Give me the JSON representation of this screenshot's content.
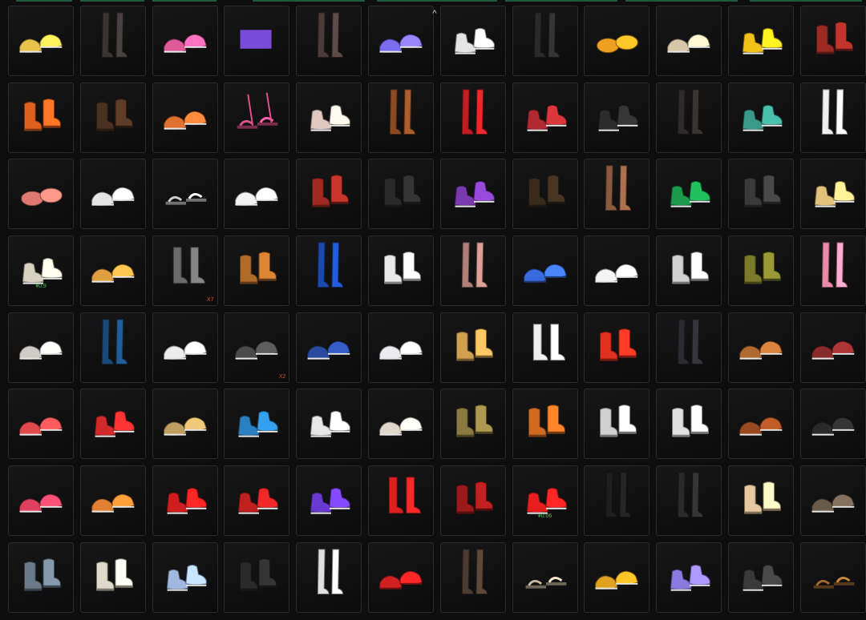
{
  "scroll_up": "^",
  "items": [
    {
      "icon": "sneakers-icon",
      "c": "#e8c24a"
    },
    {
      "icon": "legs-boots-icon",
      "c": "#3a3434"
    },
    {
      "icon": "sneakers-icon",
      "c": "#e05a9a"
    },
    {
      "icon": "strap-sneakers-icon",
      "c": "#7a4ad8"
    },
    {
      "icon": "fishnet-legs-icon",
      "c": "#4a3c38"
    },
    {
      "icon": "flats-icon",
      "c": "#7b6cf0"
    },
    {
      "icon": "cleats-icon",
      "c": "#e4e4e4"
    },
    {
      "icon": "tall-boots-icon",
      "c": "#2a2a2a"
    },
    {
      "icon": "slippers-icon",
      "c": "#f0a020"
    },
    {
      "icon": "sneakers-icon",
      "c": "#d8c6a8"
    },
    {
      "icon": "high-tops-icon",
      "c": "#f2c21a"
    },
    {
      "icon": "boots-icon",
      "c": "#9a2a22"
    },
    {
      "icon": "boots-icon",
      "c": "#e0601e"
    },
    {
      "icon": "boots-icon",
      "c": "#4a3020"
    },
    {
      "icon": "sneakers-icon",
      "c": "#e07030"
    },
    {
      "icon": "lace-sandals-icon",
      "c": "#e0508a"
    },
    {
      "icon": "high-tops-icon",
      "c": "#e0c8c0"
    },
    {
      "icon": "tall-boots-icon",
      "c": "#8a4a22"
    },
    {
      "icon": "tall-boots-icon",
      "c": "#c01e22"
    },
    {
      "icon": "high-tops-icon",
      "c": "#b02a30"
    },
    {
      "icon": "high-tops-icon",
      "c": "#2c2c2c"
    },
    {
      "icon": "legs-boots-icon",
      "c": "#2e2a2a"
    },
    {
      "icon": "high-tops-icon",
      "c": "#3a9a8a"
    },
    {
      "icon": "stockings-icon",
      "c": "#f0f0f0"
    },
    {
      "icon": "slippers-icon",
      "c": "#e07a70"
    },
    {
      "icon": "flats-icon",
      "c": "#e6e6e6"
    },
    {
      "icon": "sandals-icon",
      "c": "#cfcfcf"
    },
    {
      "icon": "sneakers-icon",
      "c": "#f2f2f2"
    },
    {
      "icon": "boots-icon",
      "c": "#a02a22"
    },
    {
      "icon": "boots-icon",
      "c": "#2a2a2a"
    },
    {
      "icon": "high-tops-icon",
      "c": "#7a3ab0"
    },
    {
      "icon": "boots-icon",
      "c": "#3a2a1a"
    },
    {
      "icon": "legs-boots-icon",
      "c": "#8a5a40"
    },
    {
      "icon": "high-tops-icon",
      "c": "#1a9a4a"
    },
    {
      "icon": "boots-icon",
      "c": "#3a3a3a"
    },
    {
      "icon": "high-tops-icon",
      "c": "#e2c27a"
    },
    {
      "icon": "high-tops-icon",
      "c": "#d8d0c0",
      "price": "¥0.9"
    },
    {
      "icon": "sneakers-icon",
      "c": "#e0a040"
    },
    {
      "icon": "socks-icon",
      "c": "#6a6a6a",
      "qty": "X7"
    },
    {
      "icon": "boots-icon",
      "c": "#b06a2a"
    },
    {
      "icon": "tall-boots-icon",
      "c": "#1a4ab0"
    },
    {
      "icon": "boots-icon",
      "c": "#e8e8e8"
    },
    {
      "icon": "legs-boots-icon",
      "c": "#b08078"
    },
    {
      "icon": "flip-flops-icon",
      "c": "#3a6ae0"
    },
    {
      "icon": "flats-icon",
      "c": "#f4f4f4"
    },
    {
      "icon": "boots-icon",
      "c": "#d0d0d0"
    },
    {
      "icon": "boots-icon",
      "c": "#7a7a2a"
    },
    {
      "icon": "stockings-icon",
      "c": "#e88aa8"
    },
    {
      "icon": "sneakers-icon",
      "c": "#d0ccc8"
    },
    {
      "icon": "tall-boots-icon",
      "c": "#1a4a7a"
    },
    {
      "icon": "sneakers-icon",
      "c": "#ececec"
    },
    {
      "icon": "loafers-icon",
      "c": "#4a4a4a",
      "qty": "X2"
    },
    {
      "icon": "loafers-icon",
      "c": "#2a4aa0"
    },
    {
      "icon": "sneakers-icon",
      "c": "#ececf0"
    },
    {
      "icon": "boots-icon",
      "c": "#d0a050"
    },
    {
      "icon": "socks-icon",
      "c": "#f0f0f0"
    },
    {
      "icon": "boots-icon",
      "c": "#e0301e"
    },
    {
      "icon": "tall-boots-icon",
      "c": "#2a2a30"
    },
    {
      "icon": "sneakers-icon",
      "c": "#b06a30"
    },
    {
      "icon": "loafers-icon",
      "c": "#8a2a2a"
    },
    {
      "icon": "sneakers-icon",
      "c": "#e04a4a"
    },
    {
      "icon": "high-tops-icon",
      "c": "#d02a2a"
    },
    {
      "icon": "sneakers-icon",
      "c": "#c0a060"
    },
    {
      "icon": "high-tops-icon",
      "c": "#2a80c0"
    },
    {
      "icon": "high-tops-icon",
      "c": "#e8e8e8"
    },
    {
      "icon": "loafers-icon",
      "c": "#e0d8c8"
    },
    {
      "icon": "boots-icon",
      "c": "#8a7a40"
    },
    {
      "icon": "boots-icon",
      "c": "#d06a20"
    },
    {
      "icon": "boots-icon",
      "c": "#d0d0d0"
    },
    {
      "icon": "boots-icon",
      "c": "#e0e0e0"
    },
    {
      "icon": "loafers-icon",
      "c": "#9a4a20"
    },
    {
      "icon": "loafers-icon",
      "c": "#2a2a2a"
    },
    {
      "icon": "sneakers-icon",
      "c": "#e04060"
    },
    {
      "icon": "sneakers-icon",
      "c": "#e08030"
    },
    {
      "icon": "high-tops-icon",
      "c": "#d01e1e"
    },
    {
      "icon": "high-tops-icon",
      "c": "#c02020"
    },
    {
      "icon": "high-tops-icon",
      "c": "#6a3ad0"
    },
    {
      "icon": "socks-icon",
      "c": "#e02020"
    },
    {
      "icon": "boots-icon",
      "c": "#9a1a1a"
    },
    {
      "icon": "high-tops-icon",
      "c": "#e81e1e",
      "price": "¥0.06"
    },
    {
      "icon": "tall-boots-icon",
      "c": "#1e1e1e"
    },
    {
      "icon": "tall-boots-icon",
      "c": "#2a2a2a"
    },
    {
      "icon": "boots-icon",
      "c": "#e8c8a0"
    },
    {
      "icon": "loafers-icon",
      "c": "#6a5a4a"
    },
    {
      "icon": "boots-icon",
      "c": "#6a7a8a"
    },
    {
      "icon": "boots-icon",
      "c": "#e0d8c8"
    },
    {
      "icon": "high-tops-icon",
      "c": "#a0b8e0"
    },
    {
      "icon": "boots-icon",
      "c": "#2a2a2a"
    },
    {
      "icon": "stockings-icon",
      "c": "#e0e0e0"
    },
    {
      "icon": "flip-flops-icon",
      "c": "#d02020"
    },
    {
      "icon": "tall-boots-icon",
      "c": "#4a3a30"
    },
    {
      "icon": "sandals-icon",
      "c": "#c8b8a0"
    },
    {
      "icon": "loafers-icon",
      "c": "#e0a020"
    },
    {
      "icon": "high-tops-icon",
      "c": "#8a7ae0"
    },
    {
      "icon": "high-tops-icon",
      "c": "#3a3a3a"
    },
    {
      "icon": "sandals-icon",
      "c": "#a06a30"
    }
  ]
}
